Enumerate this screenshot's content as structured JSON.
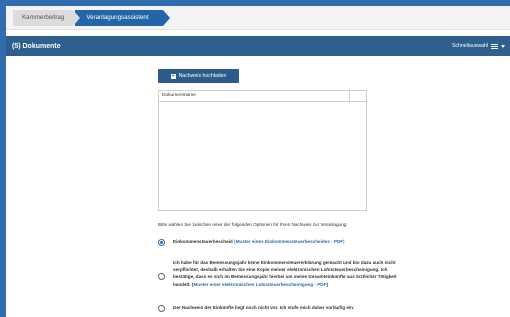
{
  "breadcrumbs": [
    "Kammerbeitrag",
    "Veranlagungsassistent"
  ],
  "section": {
    "title": "(5) Dokumente",
    "menu_label": "Schnellauswahl"
  },
  "upload_button": "Nachweis hochladen",
  "table": {
    "column_header": "Dokumentname"
  },
  "instruction": "Bitte wählen Sie zwischen einer der folgenden Optionen für Ihren Nachweis zur Veranlagung:",
  "options": [
    {
      "label": "Einkommensteuerbescheid",
      "link": "Muster eines Einkommensteuerbescheides - PDF",
      "selected": true
    },
    {
      "text": "Ich habe für das Bemessungsjahr keine Einkommensteuererklärung gemacht und bin dazu auch nicht verpflichtet, deshalb erhalten Sie eine Kopie meiner elektronischen Lohnsteuerbescheinigung. Ich bestätige, dass es sich im Bemessungsjahr hierbei um meine Gesamteinkünfte aus ärztlicher Tätigkeit handelt.",
      "link": "Muster einer elektronischen Lohnsteuerbescheinigung - PDF",
      "selected": false
    },
    {
      "text": "Der Nachweis der Einkünfte liegt noch nicht vor. Ich stufe mich daher vorläufig ein.",
      "selected": false
    }
  ]
}
